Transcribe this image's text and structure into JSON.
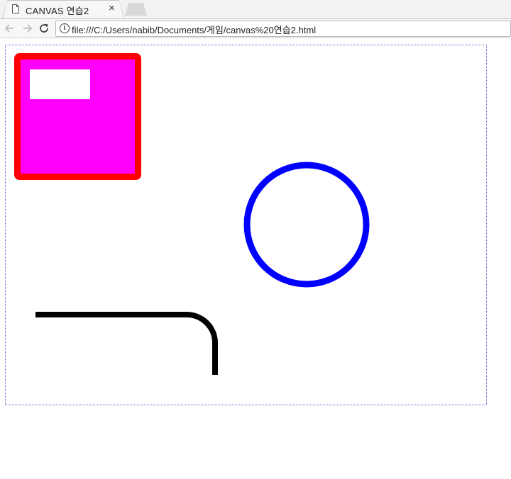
{
  "browser": {
    "tab_title": "CANVAS 연습2",
    "tab_close": "×",
    "address": "file:///C:/Users/nabib/Documents/게임/canvas%20연습2.html"
  },
  "colors": {
    "square_stroke": "#ff0000",
    "square_fill": "#ff00ff",
    "inner_rect_fill": "#ffffff",
    "circle_stroke": "#0000ff",
    "path_stroke": "#000000",
    "canvas_border": "#5a5ad6"
  },
  "icons": [
    "page-icon",
    "close-icon",
    "back-arrow-icon",
    "forward-arrow-icon",
    "reload-icon",
    "info-icon"
  ]
}
